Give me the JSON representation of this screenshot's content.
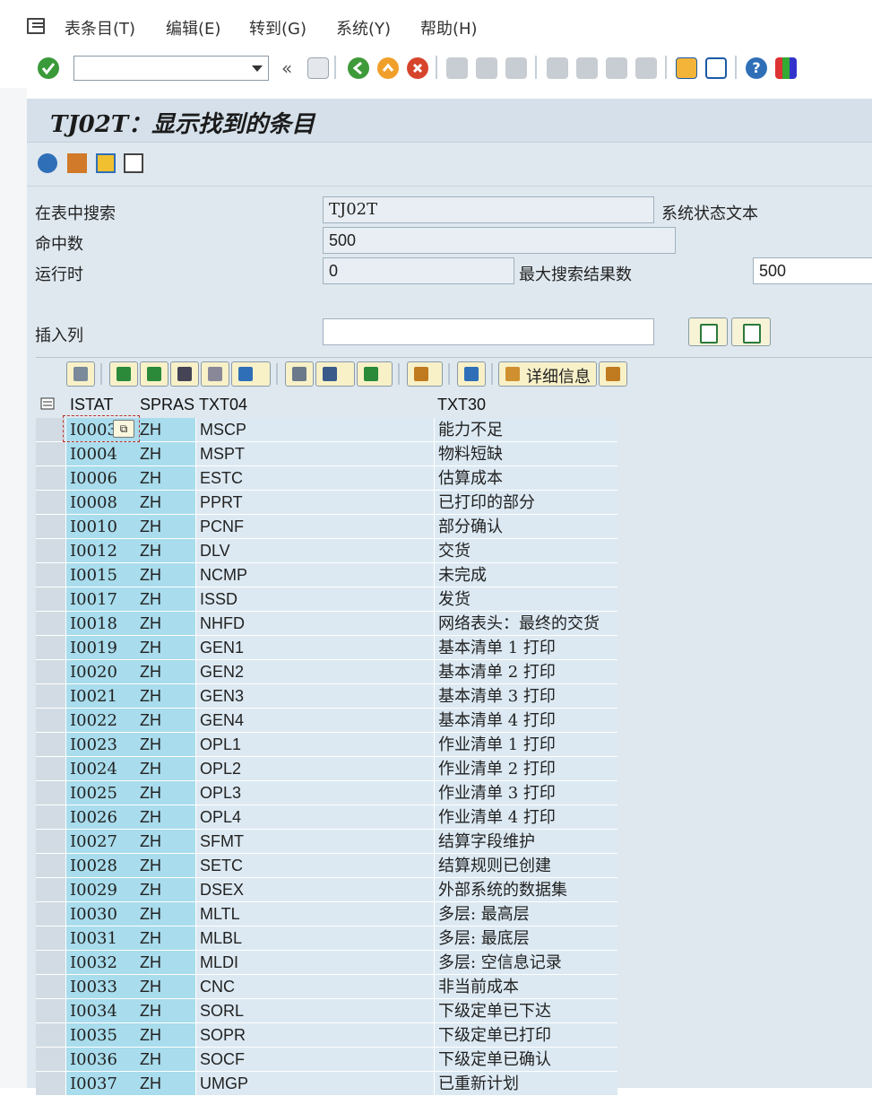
{
  "menu": {
    "items": [
      {
        "label": "表条目(T)"
      },
      {
        "label": "编辑(E)"
      },
      {
        "label": "转到(G)"
      },
      {
        "label": "系统(Y)"
      },
      {
        "label": "帮助(H)"
      }
    ]
  },
  "toolbar": {
    "command_value": "",
    "icons": [
      "enter-icon",
      "back-double-chevron-icon",
      "save-icon",
      "back-icon",
      "exit-icon",
      "cancel-icon",
      "print-icon",
      "find-icon",
      "find-next-icon",
      "first-page-icon",
      "previous-page-icon",
      "next-page-icon",
      "last-page-icon",
      "new-session-icon",
      "shortcut-icon",
      "help-icon",
      "customize-layout-icon"
    ]
  },
  "title": "TJ02T：显示找到的条目",
  "app_toolbar_icons": [
    "refresh-icon",
    "selection-criteria-icon",
    "change-icon",
    "details-icon"
  ],
  "search": {
    "in_table_label": "在表中搜索",
    "in_table_value": "TJ02T",
    "table_description": "系统状态文本",
    "hits_label": "命中数",
    "hits_value": "500",
    "runtime_label": "运行时",
    "runtime_value": "0",
    "max_hits_label": "最大搜索结果数",
    "max_hits_value": "500",
    "insert_col_label": "插入列",
    "insert_col_value": ""
  },
  "alv_toolbar": {
    "detail_label": "详细信息",
    "icons": [
      "details-icon",
      "sort-ascending-icon",
      "sort-descending-icon",
      "find-icon",
      "find-next-icon",
      "filter-icon",
      "print-preview-icon",
      "views-icon",
      "export-icon",
      "layout-icon",
      "info-icon",
      "graphic-icon",
      "abc-analysis-icon"
    ]
  },
  "table": {
    "columns": [
      "ISTAT",
      "SPRAS",
      "TXT04",
      "TXT30"
    ],
    "rows": [
      [
        "I0003",
        "ZH",
        "MSCP",
        "能力不足"
      ],
      [
        "I0004",
        "ZH",
        "MSPT",
        "物料短缺"
      ],
      [
        "I0006",
        "ZH",
        "ESTC",
        "估算成本"
      ],
      [
        "I0008",
        "ZH",
        "PPRT",
        "已打印的部分"
      ],
      [
        "I0010",
        "ZH",
        "PCNF",
        "部分确认"
      ],
      [
        "I0012",
        "ZH",
        "DLV",
        "交货"
      ],
      [
        "I0015",
        "ZH",
        "NCMP",
        "未完成"
      ],
      [
        "I0017",
        "ZH",
        "ISSD",
        "发货"
      ],
      [
        "I0018",
        "ZH",
        "NHFD",
        "网络表头：最终的交货"
      ],
      [
        "I0019",
        "ZH",
        "GEN1",
        "基本清单 1 打印"
      ],
      [
        "I0020",
        "ZH",
        "GEN2",
        "基本清单 2 打印"
      ],
      [
        "I0021",
        "ZH",
        "GEN3",
        "基本清单 3 打印"
      ],
      [
        "I0022",
        "ZH",
        "GEN4",
        "基本清单 4 打印"
      ],
      [
        "I0023",
        "ZH",
        "OPL1",
        "作业清单 1 打印"
      ],
      [
        "I0024",
        "ZH",
        "OPL2",
        "作业清单 2 打印"
      ],
      [
        "I0025",
        "ZH",
        "OPL3",
        "作业清单 3 打印"
      ],
      [
        "I0026",
        "ZH",
        "OPL4",
        "作业清单 4 打印"
      ],
      [
        "I0027",
        "ZH",
        "SFMT",
        "结算字段维护"
      ],
      [
        "I0028",
        "ZH",
        "SETC",
        "结算规则已创建"
      ],
      [
        "I0029",
        "ZH",
        "DSEX",
        "外部系统的数据集"
      ],
      [
        "I0030",
        "ZH",
        "MLTL",
        "多层: 最高层"
      ],
      [
        "I0031",
        "ZH",
        "MLBL",
        "多层: 最底层"
      ],
      [
        "I0032",
        "ZH",
        "MLDI",
        "多层: 空信息记录"
      ],
      [
        "I0033",
        "ZH",
        "CNC",
        "非当前成本"
      ],
      [
        "I0034",
        "ZH",
        "SORL",
        "下级定单已下达"
      ],
      [
        "I0035",
        "ZH",
        "SOPR",
        "下级定单已打印"
      ],
      [
        "I0036",
        "ZH",
        "SOCF",
        "下级定单已确认"
      ],
      [
        "I0037",
        "ZH",
        "UMGP",
        "已重新计划"
      ]
    ]
  },
  "colors": {
    "key_column": "#a9dcec",
    "data_column": "#dce9f2",
    "background": "#dfe8ef"
  }
}
